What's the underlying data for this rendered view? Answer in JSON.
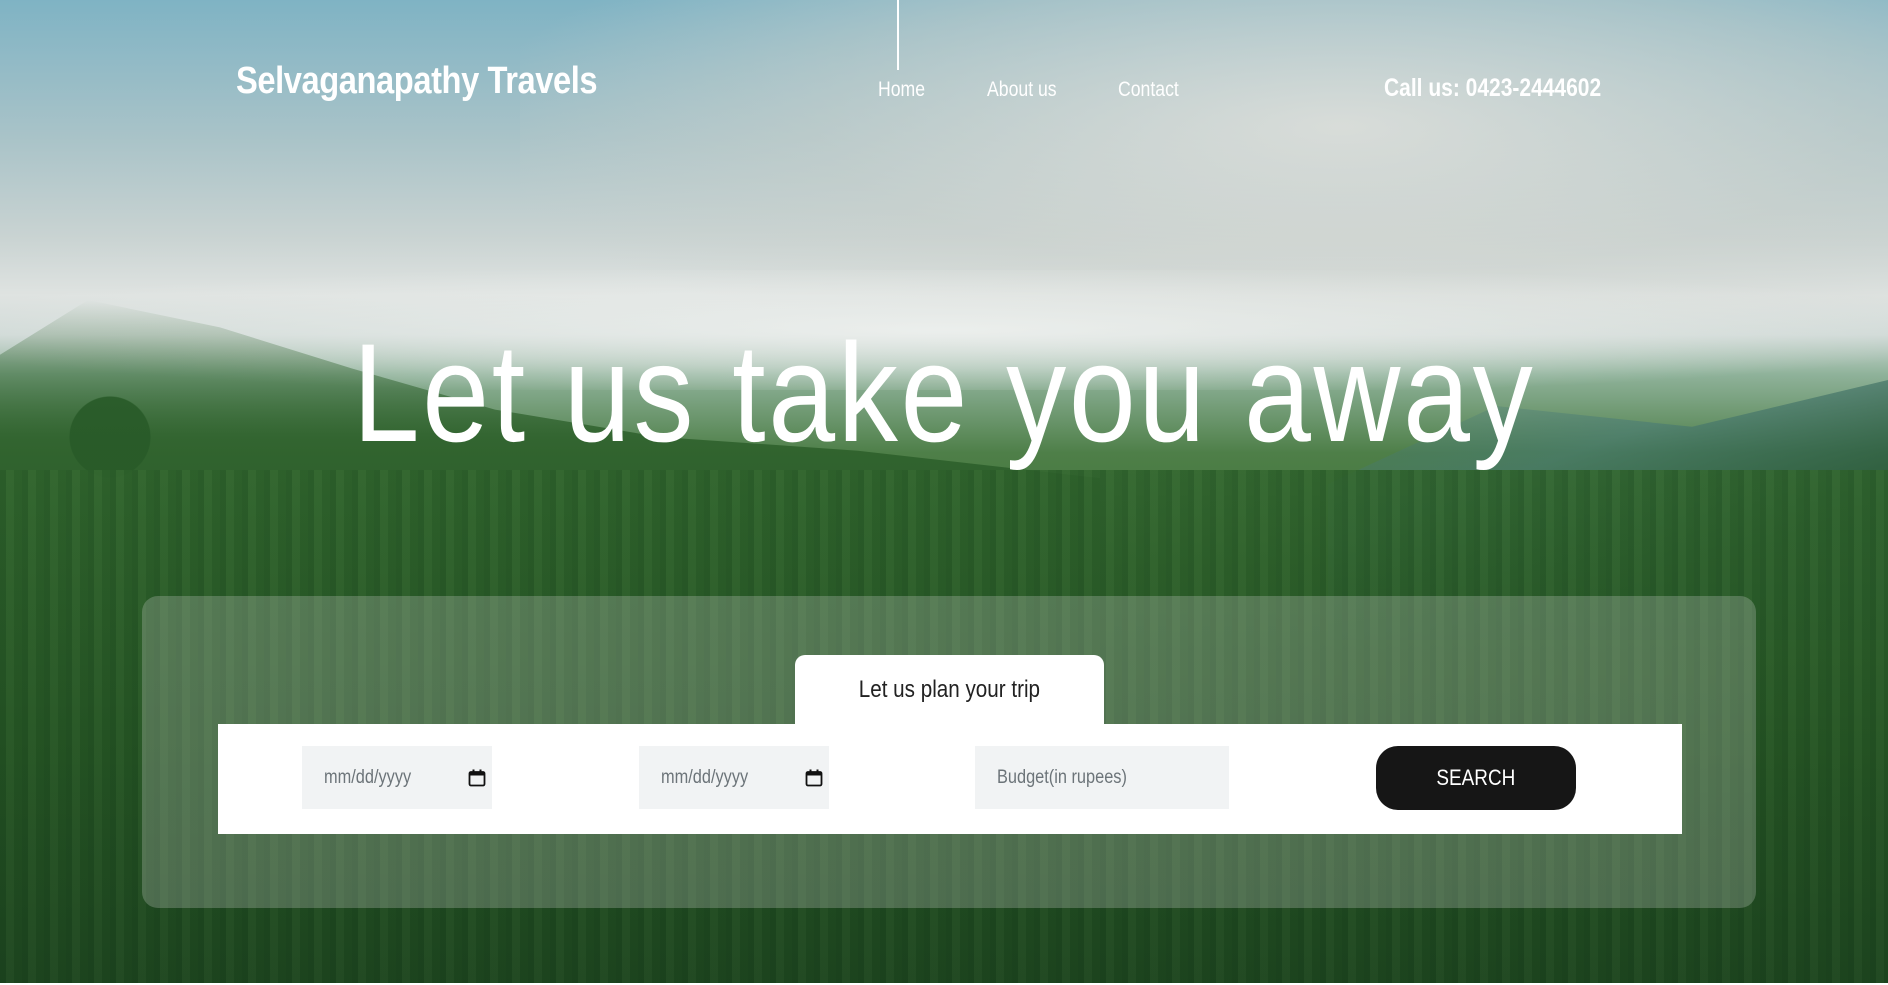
{
  "header": {
    "brand": "Selvaganapathy Travels",
    "nav": [
      {
        "label": "Home"
      },
      {
        "label": "About us"
      },
      {
        "label": "Contact"
      }
    ],
    "call": "Call us: 0423-2444602"
  },
  "hero": {
    "headline": "Let us take you away"
  },
  "planner": {
    "tab_label": "Let us plan your trip",
    "start_date_placeholder": "mm/dd/yyyy",
    "end_date_placeholder": "mm/dd/yyyy",
    "budget_placeholder": "Budget(in rupees)",
    "search_label": "SEARCH"
  },
  "icons": {
    "date_picker": "calendar-icon"
  }
}
